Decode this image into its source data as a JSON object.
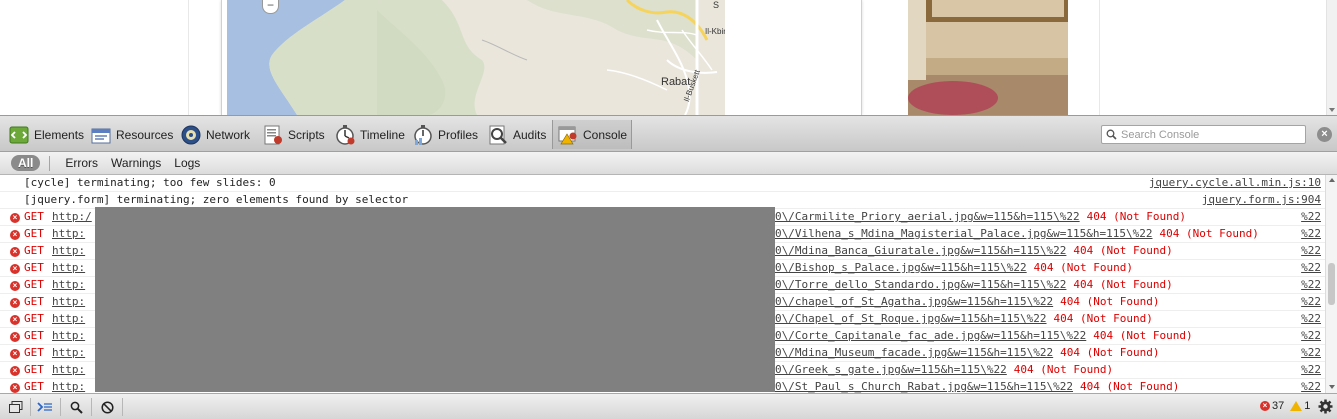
{
  "page": {
    "map_labels": {
      "town": "Rabat",
      "road_vertical": "Il-Buskett",
      "road_top": "Il-Kbir",
      "corner": "S"
    },
    "zoom_label": "−"
  },
  "toolbar": {
    "panels": [
      {
        "label": "Elements",
        "icon": "elements-icon"
      },
      {
        "label": "Resources",
        "icon": "resources-icon"
      },
      {
        "label": "Network",
        "icon": "network-icon"
      },
      {
        "label": "Scripts",
        "icon": "scripts-icon"
      },
      {
        "label": "Timeline",
        "icon": "timeline-icon"
      },
      {
        "label": "Profiles",
        "icon": "profiles-icon"
      },
      {
        "label": "Audits",
        "icon": "audits-icon"
      },
      {
        "label": "Console",
        "icon": "console-icon",
        "selected": true
      }
    ],
    "search_placeholder": "Search Console",
    "close_label": "×"
  },
  "filters": {
    "all": "All",
    "errors": "Errors",
    "warnings": "Warnings",
    "logs": "Logs"
  },
  "console": {
    "logs": [
      {
        "message": "[cycle] terminating; too few slides: 0",
        "source": "jquery.cycle.all.min.js:10"
      },
      {
        "message": "[jquery.form] terminating; zero elements found by selector",
        "source": "jquery.form.js:904"
      }
    ],
    "errors": [
      {
        "method": "GET",
        "url_start": "http:/",
        "url_end": "0\\/Carmilite_Priory_aerial.jpg&w=115&h=115\\%22",
        "status": "404 (Not Found)",
        "source": "%22"
      },
      {
        "method": "GET",
        "url_start": "http:",
        "url_end": "0\\/Vilhena_s_Mdina_Magisterial_Palace.jpg&w=115&h=115\\%22",
        "status": "404 (Not Found)",
        "source": "%22"
      },
      {
        "method": "GET",
        "url_start": "http:",
        "url_end": "0\\/Mdina_Banca_Giuratale.jpg&w=115&h=115\\%22",
        "status": "404 (Not Found)",
        "source": "%22"
      },
      {
        "method": "GET",
        "url_start": "http:",
        "url_end": "0\\/Bishop_s_Palace.jpg&w=115&h=115\\%22",
        "status": "404 (Not Found)",
        "source": "%22"
      },
      {
        "method": "GET",
        "url_start": "http:",
        "url_end": "0\\/Torre_dello_Standardo.jpg&w=115&h=115\\%22",
        "status": "404 (Not Found)",
        "source": "%22"
      },
      {
        "method": "GET",
        "url_start": "http:",
        "url_end": "0\\/chapel_of_St_Agatha.jpg&w=115&h=115\\%22",
        "status": "404 (Not Found)",
        "source": "%22"
      },
      {
        "method": "GET",
        "url_start": "http:",
        "url_end": "0\\/Chapel_of_St_Roque.jpg&w=115&h=115\\%22",
        "status": "404 (Not Found)",
        "source": "%22"
      },
      {
        "method": "GET",
        "url_start": "http:",
        "url_end": "0\\/Corte_Capitanale_fac_ade.jpg&w=115&h=115\\%22",
        "status": "404 (Not Found)",
        "source": "%22"
      },
      {
        "method": "GET",
        "url_start": "http:",
        "url_end": "0\\/Mdina_Museum_facade.jpg&w=115&h=115\\%22",
        "status": "404 (Not Found)",
        "source": "%22"
      },
      {
        "method": "GET",
        "url_start": "http:",
        "url_end": "0\\/Greek_s_gate.jpg&w=115&h=115\\%22",
        "status": "404 (Not Found)",
        "source": "%22"
      },
      {
        "method": "GET",
        "url_start": "http:",
        "url_end": "0\\/St_Paul_s_Church_Rabat.jpg&w=115&h=115\\%22",
        "status": "404 (Not Found)",
        "source": "%22"
      }
    ]
  },
  "statusbar": {
    "error_count": "37",
    "warning_count": "1"
  },
  "colors": {
    "error_red": "#d00000",
    "map_sea": "#a7bfe0",
    "map_land": "#eae6dc",
    "redaction": "#808080"
  }
}
